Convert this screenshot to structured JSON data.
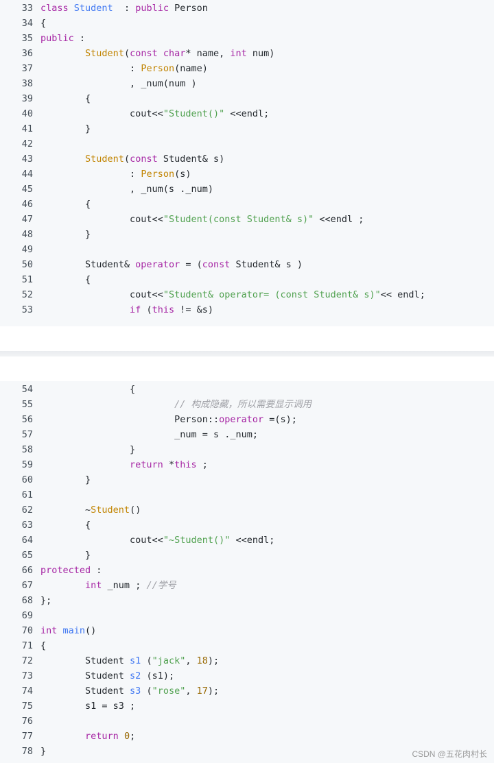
{
  "blocks": [
    {
      "lines": [
        {
          "n": "33",
          "t": [
            [
              "kw",
              "class "
            ],
            [
              "cls",
              "Student"
            ],
            [
              "",
              "  : "
            ],
            [
              "kw",
              "public "
            ],
            [
              "",
              "Person"
            ]
          ]
        },
        {
          "n": "34",
          "t": [
            [
              "",
              "{"
            ]
          ]
        },
        {
          "n": "35",
          "t": [
            [
              "kw",
              "public"
            ],
            [
              "",
              " :"
            ]
          ]
        },
        {
          "n": "36",
          "t": [
            [
              "",
              "        "
            ],
            [
              "fn",
              "Student"
            ],
            [
              "",
              "("
            ],
            [
              "kw",
              "const char"
            ],
            [
              "",
              "* name, "
            ],
            [
              "kw",
              "int"
            ],
            [
              "",
              " num)"
            ]
          ]
        },
        {
          "n": "37",
          "t": [
            [
              "",
              "                : "
            ],
            [
              "fn",
              "Person"
            ],
            [
              "",
              "(name)"
            ]
          ]
        },
        {
          "n": "38",
          "t": [
            [
              "",
              "                , _num(num )"
            ]
          ]
        },
        {
          "n": "39",
          "t": [
            [
              "",
              "        {"
            ]
          ]
        },
        {
          "n": "40",
          "t": [
            [
              "",
              "                cout<<"
            ],
            [
              "str",
              "\"Student()\""
            ],
            [
              "",
              " <<endl;"
            ]
          ]
        },
        {
          "n": "41",
          "t": [
            [
              "",
              "        }"
            ]
          ]
        },
        {
          "n": "42",
          "t": [
            [
              "",
              ""
            ]
          ]
        },
        {
          "n": "43",
          "t": [
            [
              "",
              "        "
            ],
            [
              "fn",
              "Student"
            ],
            [
              "",
              "("
            ],
            [
              "kw",
              "const"
            ],
            [
              "",
              " Student& s)"
            ]
          ]
        },
        {
          "n": "44",
          "t": [
            [
              "",
              "                : "
            ],
            [
              "fn",
              "Person"
            ],
            [
              "",
              "(s)"
            ]
          ]
        },
        {
          "n": "45",
          "t": [
            [
              "",
              "                , _num(s ._num)"
            ]
          ]
        },
        {
          "n": "46",
          "t": [
            [
              "",
              "        {"
            ]
          ]
        },
        {
          "n": "47",
          "t": [
            [
              "",
              "                cout<<"
            ],
            [
              "str",
              "\"Student(const Student& s)\""
            ],
            [
              "",
              " <<endl ;"
            ]
          ]
        },
        {
          "n": "48",
          "t": [
            [
              "",
              "        }"
            ]
          ]
        },
        {
          "n": "49",
          "t": [
            [
              "",
              ""
            ]
          ]
        },
        {
          "n": "50",
          "t": [
            [
              "",
              "        Student& "
            ],
            [
              "kw",
              "operator"
            ],
            [
              "",
              " = ("
            ],
            [
              "kw",
              "const"
            ],
            [
              "",
              " Student& s )"
            ]
          ]
        },
        {
          "n": "51",
          "t": [
            [
              "",
              "        {"
            ]
          ]
        },
        {
          "n": "52",
          "t": [
            [
              "",
              "                cout<<"
            ],
            [
              "str",
              "\"Student& operator= (const Student& s)\""
            ],
            [
              "",
              "<< endl;"
            ]
          ]
        },
        {
          "n": "53",
          "t": [
            [
              "",
              "                "
            ],
            [
              "kw",
              "if"
            ],
            [
              "",
              " ("
            ],
            [
              "kw",
              "this"
            ],
            [
              "",
              " != &s)"
            ]
          ]
        }
      ]
    },
    {
      "lines": [
        {
          "n": "54",
          "t": [
            [
              "",
              "                {"
            ]
          ]
        },
        {
          "n": "55",
          "t": [
            [
              "",
              "                        "
            ],
            [
              "cmt",
              "// 构成隐藏，所以需要显示调用"
            ]
          ]
        },
        {
          "n": "56",
          "t": [
            [
              "",
              "                        Person::"
            ],
            [
              "kw",
              "operator"
            ],
            [
              "",
              " =(s);"
            ]
          ]
        },
        {
          "n": "57",
          "t": [
            [
              "",
              "                        _num = s ._num;"
            ]
          ]
        },
        {
          "n": "58",
          "t": [
            [
              "",
              "                }"
            ]
          ]
        },
        {
          "n": "59",
          "t": [
            [
              "",
              "                "
            ],
            [
              "kw",
              "return"
            ],
            [
              "",
              " *"
            ],
            [
              "kw",
              "this"
            ],
            [
              "",
              " ;"
            ]
          ]
        },
        {
          "n": "60",
          "t": [
            [
              "",
              "        }"
            ]
          ]
        },
        {
          "n": "61",
          "t": [
            [
              "",
              ""
            ]
          ]
        },
        {
          "n": "62",
          "t": [
            [
              "",
              "        ~"
            ],
            [
              "fn",
              "Student"
            ],
            [
              "",
              "()"
            ]
          ]
        },
        {
          "n": "63",
          "t": [
            [
              "",
              "        {"
            ]
          ]
        },
        {
          "n": "64",
          "t": [
            [
              "",
              "                cout<<"
            ],
            [
              "str",
              "\"~Student()\""
            ],
            [
              "",
              " <<endl;"
            ]
          ]
        },
        {
          "n": "65",
          "t": [
            [
              "",
              "        }"
            ]
          ]
        },
        {
          "n": "66",
          "t": [
            [
              "kw",
              "protected"
            ],
            [
              "",
              " :"
            ]
          ]
        },
        {
          "n": "67",
          "t": [
            [
              "",
              "        "
            ],
            [
              "kw",
              "int"
            ],
            [
              "",
              " _num ; "
            ],
            [
              "cmt",
              "//学号"
            ]
          ]
        },
        {
          "n": "68",
          "t": [
            [
              "",
              "};"
            ]
          ]
        },
        {
          "n": "69",
          "t": [
            [
              "",
              ""
            ]
          ]
        },
        {
          "n": "70",
          "t": [
            [
              "kw",
              "int "
            ],
            [
              "cls",
              "main"
            ],
            [
              "",
              "()"
            ]
          ]
        },
        {
          "n": "71",
          "t": [
            [
              "",
              "{"
            ]
          ]
        },
        {
          "n": "72",
          "t": [
            [
              "",
              "        Student "
            ],
            [
              "cls",
              "s1"
            ],
            [
              "",
              " ("
            ],
            [
              "str",
              "\"jack\""
            ],
            [
              "",
              ", "
            ],
            [
              "num",
              "18"
            ],
            [
              "",
              ");"
            ]
          ]
        },
        {
          "n": "73",
          "t": [
            [
              "",
              "        Student "
            ],
            [
              "cls",
              "s2"
            ],
            [
              "",
              " (s1);"
            ]
          ]
        },
        {
          "n": "74",
          "t": [
            [
              "",
              "        Student "
            ],
            [
              "cls",
              "s3"
            ],
            [
              "",
              " ("
            ],
            [
              "str",
              "\"rose\""
            ],
            [
              "",
              ", "
            ],
            [
              "num",
              "17"
            ],
            [
              "",
              ");"
            ]
          ]
        },
        {
          "n": "75",
          "t": [
            [
              "",
              "        s1 = s3 ;"
            ]
          ]
        },
        {
          "n": "76",
          "t": [
            [
              "",
              ""
            ]
          ]
        },
        {
          "n": "77",
          "t": [
            [
              "",
              "        "
            ],
            [
              "kw",
              "return "
            ],
            [
              "num",
              "0"
            ],
            [
              "",
              ";"
            ]
          ]
        },
        {
          "n": "78",
          "t": [
            [
              "",
              "}"
            ]
          ]
        }
      ]
    }
  ],
  "watermark": "CSDN @五花肉村长"
}
